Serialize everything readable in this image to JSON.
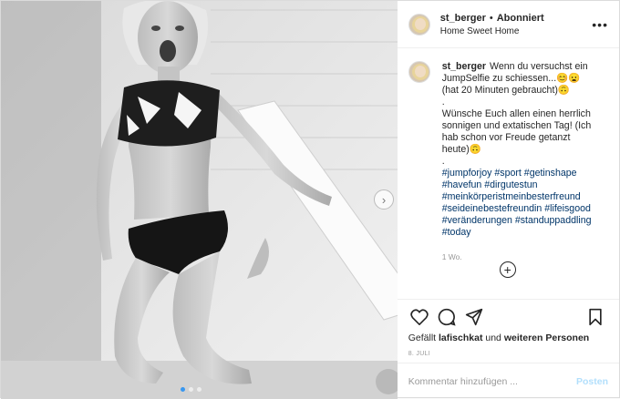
{
  "photo": {
    "icons": {
      "next": "chevron-right-icon"
    },
    "dots_count": 3,
    "active_dot": 0
  },
  "header": {
    "username": "st_berger",
    "separator": "•",
    "follow_status": "Abonniert",
    "location": "Home Sweet Home",
    "more_icon": "more-horizontal-icon"
  },
  "caption": {
    "username": "st_berger",
    "text_line1": "Wenn du versuchst ein JumpSelfie zu schiessen...😊😦(hat 20 Minuten gebraucht)🙃",
    "dot1": ".",
    "text_line2": "Wünsche Euch allen einen herrlich sonnigen und extatischen Tag! (Ich hab schon vor Freude getanzt heute)🙃",
    "dot2": ".",
    "hashtags_line1": "#jumpforjoy #sport #getinshape",
    "hashtags_line2": "#havefun #dirgutestun",
    "hashtags_line3": "#meinkörperistmeinbesterfreund",
    "hashtags_line4": "#seideinebestefreundin #lifeisgood",
    "hashtags_line5": "#veränderungen #standuppaddling",
    "hashtags_line6": "#today",
    "time": "1 Wo."
  },
  "load_more_icon": "plus-circle-icon",
  "actions": {
    "icons": [
      "heart-icon",
      "comment-icon",
      "share-icon",
      "bookmark-icon"
    ],
    "likes_prefix": "Gefällt",
    "likes_user": "lafischkat",
    "likes_and": "und",
    "likes_others": "weiteren Personen",
    "date": "8. JULI"
  },
  "comment": {
    "placeholder": "Kommentar hinzufügen ...",
    "post_label": "Posten"
  }
}
